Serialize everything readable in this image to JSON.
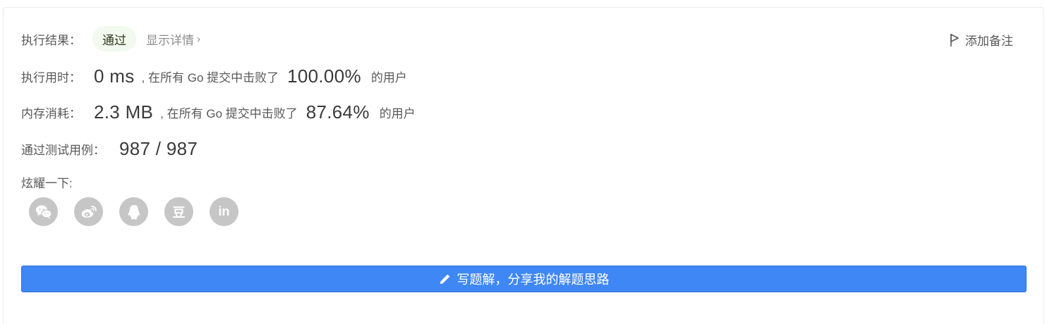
{
  "result": {
    "label": "执行结果：",
    "status": "通过",
    "details_link": "显示详情",
    "details_chevron": "›",
    "add_note": "添加备注"
  },
  "runtime": {
    "label": "执行用时：",
    "value": "0 ms",
    "middle": ", 在所有 Go 提交中击败了",
    "percent": "100.00%",
    "suffix": "的用户"
  },
  "memory": {
    "label": "内存消耗：",
    "value": "2.3 MB",
    "middle": ", 在所有 Go 提交中击败了",
    "percent": "87.64%",
    "suffix": "的用户"
  },
  "tests": {
    "label": "通过测试用例：",
    "value": "987 / 987"
  },
  "share": {
    "label": "炫耀一下:",
    "icons": [
      "wechat-icon",
      "weibo-icon",
      "qq-icon",
      "douban-icon",
      "linkedin-icon"
    ],
    "douban_glyph": "豆",
    "linkedin_glyph": "in"
  },
  "write_solution": {
    "label": "写题解，分享我的解题思路"
  },
  "colors": {
    "primary_button": "#3f87f5",
    "success_badge_bg": "#f2f9ee",
    "share_icon_bg": "#c6c6c6"
  }
}
